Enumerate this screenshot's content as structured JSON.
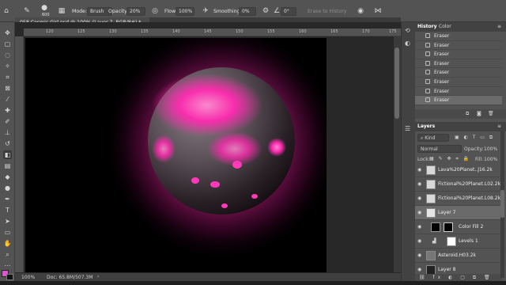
{
  "options_bar": {
    "brush_size": "600",
    "mode_label": "Mode:",
    "mode_value": "Brush",
    "opacity_label": "Opacity:",
    "opacity_value": "20%",
    "flow_label": "Flow:",
    "flow_value": "100%",
    "smoothing_label": "Smoothing:",
    "smoothing_value": "0%",
    "angle_value": "0°",
    "erase_to_history": "Erase to History"
  },
  "document": {
    "tab_title": "058 Cosmic Girl.psd @ 100% (Layer 7, RGB/8#) *",
    "ruler_ticks": [
      "120",
      "125",
      "130",
      "135",
      "140",
      "145",
      "150",
      "155",
      "160",
      "165",
      "170",
      "175"
    ]
  },
  "status_bar": {
    "zoom": "100%",
    "doc_info": "Doc: 65.8M/507.3M"
  },
  "history_panel": {
    "tabs": [
      "History",
      "Color"
    ],
    "items": [
      "Eraser",
      "Eraser",
      "Eraser",
      "Eraser",
      "Eraser",
      "Eraser",
      "Eraser",
      "Eraser"
    ]
  },
  "layers_panel": {
    "tab": "Layers",
    "filter_value": "Kind",
    "blend_mode": "Normal",
    "opacity_label": "Opacity:",
    "opacity_value": "100%",
    "lock_label": "Lock:",
    "fill_label": "Fill:",
    "fill_value": "100%",
    "layers": [
      {
        "name": "Lava%20Planet..J16.2k"
      },
      {
        "name": "Fictional%20Planet.L02.2k"
      },
      {
        "name": "Fictional%20Planet.L08.2k"
      },
      {
        "name": "Layer 7"
      },
      {
        "name": "Color Fill 2"
      },
      {
        "name": "Levels 1"
      },
      {
        "name": "Asteroid.H03.2k"
      },
      {
        "name": "Layer 8"
      }
    ]
  },
  "colors": {
    "foreground": "#e84fd6",
    "accent": "#ff2aa8"
  }
}
